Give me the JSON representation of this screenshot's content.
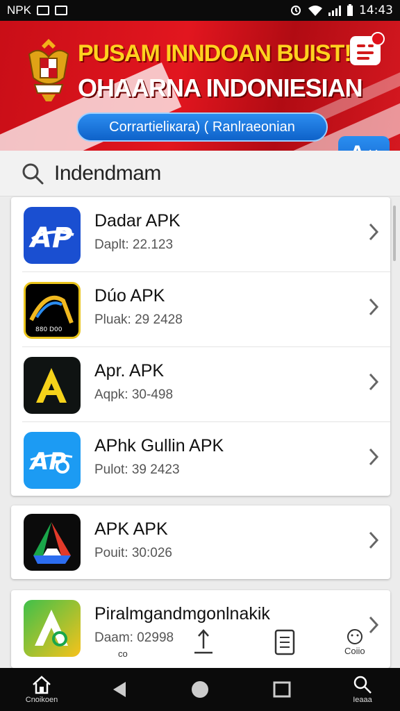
{
  "status_bar": {
    "left_text": "NPK",
    "time": "14:43"
  },
  "banner": {
    "title_line1": "PUSAM INNDOAN BUIST!",
    "title_line2": "OHAARNA INDONIESIAN",
    "pill_text": "Corrartieliкara) ( Ranlraeonian",
    "translate_label": "A",
    "translate_close": "×",
    "colors": {
      "red": "#d7141f",
      "yellow": "#ffd21f",
      "blue": "#1a74dc"
    }
  },
  "search": {
    "query": "Indendmam",
    "icon": "search-icon"
  },
  "apps": [
    {
      "name": "Dadar APK",
      "sub": "Daplt: 22.123",
      "icon": "app-ap-blue-icon"
    },
    {
      "name": "Dúo APK",
      "sub": "Pluak: 29 2428",
      "icon": "app-dua-gold-icon"
    },
    {
      "name": "Apr. APK",
      "sub": "Aqpk: 30-498",
      "icon": "app-yellow-a-icon"
    },
    {
      "name": "APhk Gullin APK",
      "sub": "Pulot: 39 2423",
      "icon": "app-cyan-ap-icon"
    },
    {
      "name": "APK APK",
      "sub": "Pouit: 30:026",
      "icon": "app-drive-triangle-icon"
    },
    {
      "name": "Piralmgandmgonlnakik",
      "sub": "Daam: 02998",
      "icon": "app-green-a-icon"
    }
  ],
  "mini_tools": {
    "left_label": "co",
    "right_label": "Coiio"
  },
  "navbar": {
    "home_label": "Cnoikoen",
    "search_label": "Ieaaa"
  }
}
